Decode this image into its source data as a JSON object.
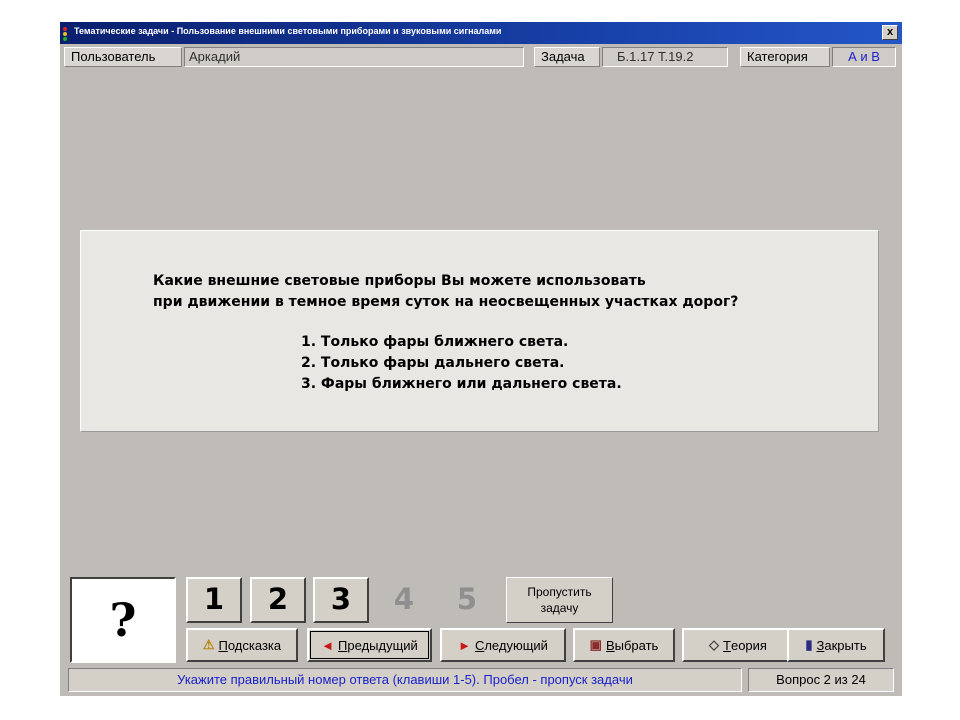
{
  "window": {
    "title": "Тематические задачи - Пользование внешними световыми приборами и звуковыми сигналами",
    "close_label": "x"
  },
  "info": {
    "user_label": "Пользователь",
    "user_value": "Аркадий",
    "task_label": "Задача",
    "task_value": "Б.1.17  Т.19.2",
    "category_label": "Категория",
    "category_value": "А и В",
    "category_color": "#1a22cc"
  },
  "question": {
    "line1": "Какие внешние световые приборы Вы можете использовать",
    "line2": "при движении в темное время суток на неосвещенных участках дорог?",
    "answers": [
      "1. Только фары ближнего света.",
      "2. Только фары дальнего света.",
      "3. Фары ближнего или дальнего света."
    ]
  },
  "controls": {
    "status_symbol": "?",
    "numbers": [
      "1",
      "2",
      "3",
      "4",
      "5"
    ],
    "skip_line1": "Пропустить",
    "skip_line2": "задачу",
    "hint": {
      "key": "П",
      "rest": "одсказка",
      "icon": "warning-icon"
    },
    "prev": {
      "key": "П",
      "rest": "редыдущий",
      "icon": "arrow-left-icon"
    },
    "next": {
      "key": "С",
      "rest": "ледующий",
      "icon": "arrow-right-icon"
    },
    "choose": {
      "key": "В",
      "rest": "ыбрать",
      "icon": "printer-icon"
    },
    "theory": {
      "key": "Т",
      "rest": "еория",
      "icon": "diamond-icon"
    },
    "close": {
      "key": "З",
      "rest": "акрыть",
      "icon": "door-icon"
    }
  },
  "status": {
    "hint": "Укажите правильный номер ответа (клавиши 1-5). Пробел - пропуск задачи",
    "hint_color": "#1a22cc",
    "counter": "Вопрос 2 из 24"
  }
}
